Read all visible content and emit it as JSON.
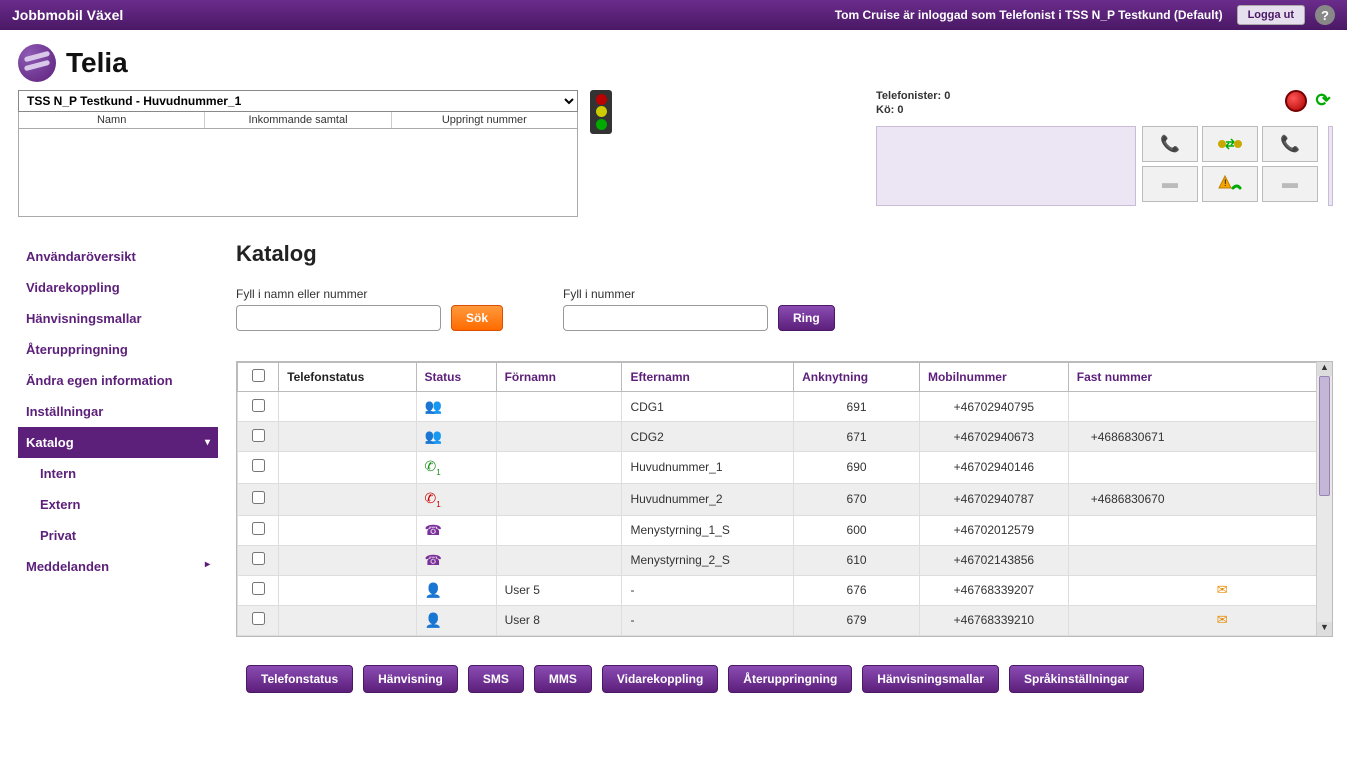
{
  "topbar": {
    "title": "Jobbmobil Växel",
    "status": "Tom Cruise är inloggad som Telefonist i TSS N_P Testkund (Default)",
    "logout": "Logga ut"
  },
  "logo": {
    "text": "Telia"
  },
  "call_panel": {
    "selected": "TSS N_P Testkund - Huvudnummer_1",
    "col_name": "Namn",
    "col_incoming": "Inkommande samtal",
    "col_dialed": "Uppringt nummer"
  },
  "queue": {
    "telefonister_label": "Telefonister:",
    "telefonister_value": "0",
    "ko_label": "Kö:",
    "ko_value": "0"
  },
  "sidebar": {
    "items": [
      "Användaröversikt",
      "Vidarekoppling",
      "Hänvisningsmallar",
      "Återuppringning",
      "Ändra egen information",
      "Inställningar",
      "Katalog",
      "Intern",
      "Extern",
      "Privat",
      "Meddelanden"
    ]
  },
  "page": {
    "title": "Katalog",
    "search_name_label": "Fyll i namn eller nummer",
    "search_number_label": "Fyll i nummer",
    "search_btn": "Sök",
    "ring_btn": "Ring"
  },
  "table": {
    "headers": {
      "telefonstatus": "Telefonstatus",
      "status": "Status",
      "fornamn": "Förnamn",
      "efternamn": "Efternamn",
      "anknytning": "Anknytning",
      "mobilnummer": "Mobilnummer",
      "fastnummer": "Fast nummer"
    },
    "rows": [
      {
        "status_icon": "group-green",
        "fornamn": "",
        "efternamn": "CDG1",
        "ext": "691",
        "mob": "+46702940795",
        "fixed": ""
      },
      {
        "status_icon": "group-green",
        "fornamn": "",
        "efternamn": "CDG2",
        "ext": "671",
        "mob": "+46702940673",
        "fixed": "+4686830671"
      },
      {
        "status_icon": "phone-green",
        "fornamn": "",
        "efternamn": "Huvudnummer_1",
        "ext": "690",
        "mob": "+46702940146",
        "fixed": ""
      },
      {
        "status_icon": "phone-red",
        "fornamn": "",
        "efternamn": "Huvudnummer_2",
        "ext": "670",
        "mob": "+46702940787",
        "fixed": "+4686830670"
      },
      {
        "status_icon": "fax-purple",
        "fornamn": "",
        "efternamn": "Menystyrning_1_S",
        "ext": "600",
        "mob": "+46702012579",
        "fixed": ""
      },
      {
        "status_icon": "fax-purple",
        "fornamn": "",
        "efternamn": "Menystyrning_2_S",
        "ext": "610",
        "mob": "+46702143856",
        "fixed": ""
      },
      {
        "status_icon": "person-green",
        "fornamn": "User 5",
        "efternamn": "-",
        "ext": "676",
        "mob": "+46768339207",
        "fixed": "",
        "msg": true
      },
      {
        "status_icon": "person-green",
        "fornamn": "User 8",
        "efternamn": "-",
        "ext": "679",
        "mob": "+46768339210",
        "fixed": "",
        "msg": true
      }
    ]
  },
  "bottom": {
    "btns": [
      "Telefonstatus",
      "Hänvisning",
      "SMS",
      "MMS",
      "Vidarekoppling",
      "Återuppringning",
      "Hänvisningsmallar",
      "Språkinställningar"
    ]
  }
}
